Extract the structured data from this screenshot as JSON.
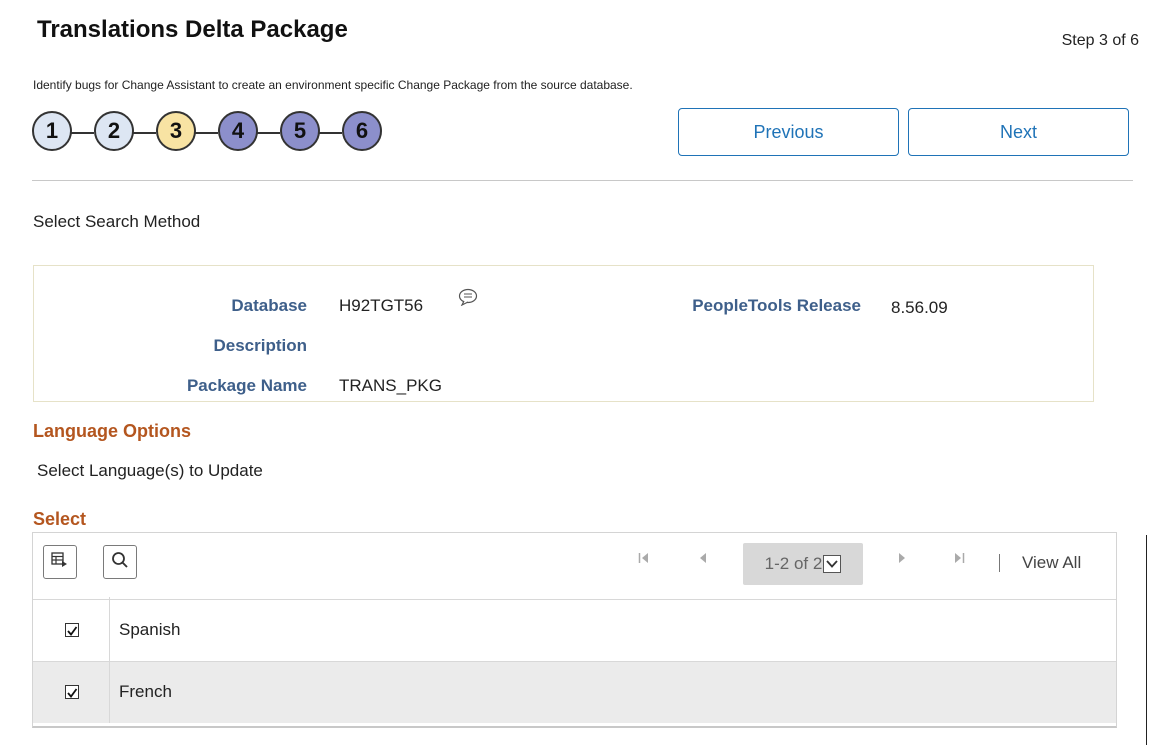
{
  "header": {
    "title": "Translations Delta Package",
    "step_indicator": "Step 3 of 6",
    "subtitle": "Identify bugs for Change Assistant to create an environment specific Change Package from the source database."
  },
  "steps": [
    {
      "label": "1",
      "state": "completed",
      "color": "#dde6f3"
    },
    {
      "label": "2",
      "state": "completed",
      "color": "#dde6f3"
    },
    {
      "label": "3",
      "state": "current",
      "color": "#f8e3a3"
    },
    {
      "label": "4",
      "state": "upcoming",
      "color": "#8c8fcb"
    },
    {
      "label": "5",
      "state": "upcoming",
      "color": "#8c8fcb"
    },
    {
      "label": "6",
      "state": "upcoming",
      "color": "#8c8fcb"
    }
  ],
  "nav": {
    "previous_label": "Previous",
    "next_label": "Next"
  },
  "search_method_label": "Select Search Method",
  "info": {
    "database_label": "Database",
    "database_value": "H92TGT56",
    "description_label": "Description",
    "description_value": "",
    "package_name_label": "Package Name",
    "package_name_value": "TRANS_PKG",
    "peopletools_label": "PeopleTools Release",
    "peopletools_value": "8.56.09"
  },
  "language_options": {
    "heading": "Language Options",
    "prompt": "Select Language(s) to Update"
  },
  "grid": {
    "heading": "Select",
    "pager_text": "1-2 of 2",
    "view_all_label": "View All",
    "rows": [
      {
        "label": "Spanish",
        "checked": true
      },
      {
        "label": "French",
        "checked": true
      }
    ]
  },
  "colors": {
    "accent": "#1f73b7",
    "label_blue": "#3e5f8a",
    "section_orange": "#b4561f"
  },
  "icons": {
    "comment": "speech-bubble-icon",
    "personalize": "grid-personalize-icon",
    "find": "search-icon",
    "first": "first-page-icon",
    "prev": "previous-page-icon",
    "next": "next-page-icon",
    "last": "last-page-icon",
    "dropdown": "chevron-down-icon",
    "check": "checkmark-icon"
  }
}
